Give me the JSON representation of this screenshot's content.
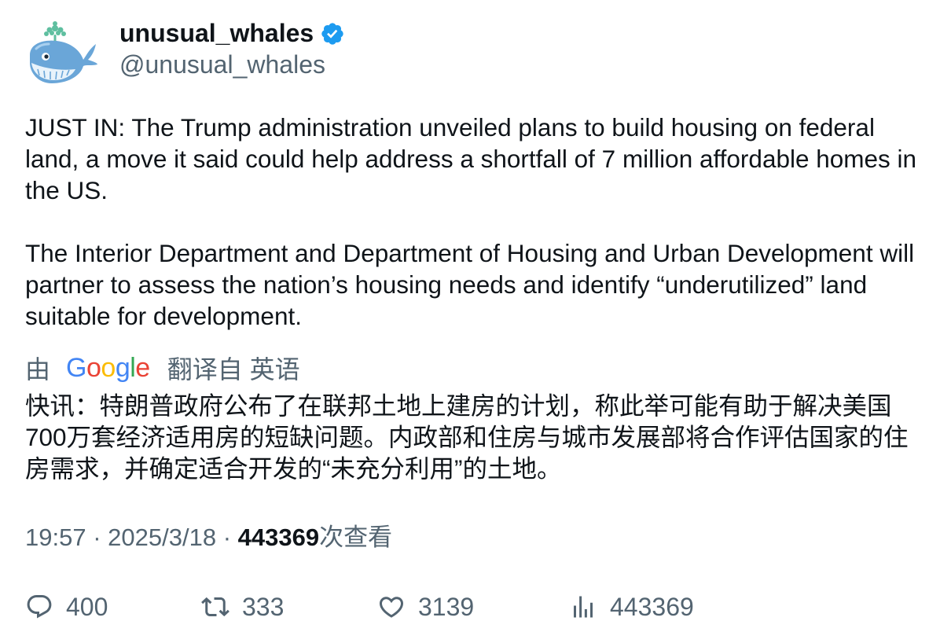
{
  "author": {
    "display_name": "unusual_whales",
    "handle": "@unusual_whales",
    "verified_icon": "verified-badge-icon",
    "verified_color": "#1d9bf0",
    "avatar_icon": "whale-avatar-icon"
  },
  "tweet": {
    "text": "JUST IN: The Trump administration unveiled plans to build housing on federal land, a move it said could help address a shortfall of 7 million affordable homes in the US.\n\nThe Interior Department and Department of Housing and Urban Development will partner to assess the nation’s housing needs and identify “underutilized” land suitable for development."
  },
  "translation": {
    "prefix": "由",
    "provider": "Google",
    "suffix": "翻译自 英语",
    "text": "快讯：特朗普政府公布了在联邦土地上建房的计划，称此举可能有助于解决美国700万套经济适用房的短缺问题。内政部和住房与城市发展部将合作评估国家的住房需求，并确定适合开发的“未充分利用”的土地。"
  },
  "meta": {
    "time": "19:57",
    "separator": "·",
    "date": "2025/3/18",
    "views_count": "443369",
    "views_label": "次查看"
  },
  "actions": {
    "reply": {
      "icon": "reply-icon",
      "count": "400"
    },
    "retweet": {
      "icon": "retweet-icon",
      "count": "333"
    },
    "like": {
      "icon": "heart-icon",
      "count": "3139"
    },
    "views": {
      "icon": "analytics-icon",
      "count": "443369"
    }
  },
  "colors": {
    "text_primary": "#0f1419",
    "text_secondary": "#536471",
    "google_blue": "#4285F4",
    "google_red": "#EA4335",
    "google_yellow": "#FBBC05",
    "google_green": "#34A853"
  }
}
